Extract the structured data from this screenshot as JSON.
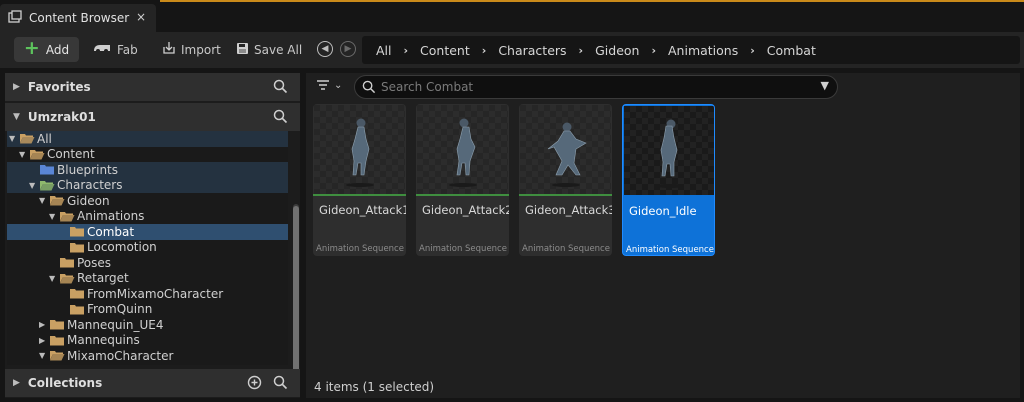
{
  "tab": {
    "title": "Content Browser",
    "close": "×"
  },
  "toolbar": {
    "add_label": "Add",
    "fab_label": "Fab",
    "import_label": "Import",
    "save_all_label": "Save All"
  },
  "breadcrumb": [
    "All",
    "Content",
    "Characters",
    "Gideon",
    "Animations",
    "Combat"
  ],
  "left_panel": {
    "favorites_label": "Favorites",
    "project_label": "Umzrak01",
    "collections_label": "Collections",
    "tree": [
      {
        "label": "All",
        "depth": 0,
        "expanded": true,
        "band": true
      },
      {
        "label": "Content",
        "depth": 1,
        "expanded": true,
        "band": false
      },
      {
        "label": "Blueprints",
        "depth": 2,
        "expanded": null,
        "band": true,
        "folder": "blue"
      },
      {
        "label": "Characters",
        "depth": 2,
        "expanded": true,
        "band": true
      },
      {
        "label": "Gideon",
        "depth": 3,
        "expanded": true,
        "band": false
      },
      {
        "label": "Animations",
        "depth": 4,
        "expanded": true,
        "band": false
      },
      {
        "label": "Combat",
        "depth": 5,
        "expanded": null,
        "selected": true
      },
      {
        "label": "Locomotion",
        "depth": 5,
        "expanded": null
      },
      {
        "label": "Poses",
        "depth": 4,
        "expanded": null
      },
      {
        "label": "Retarget",
        "depth": 4,
        "expanded": true
      },
      {
        "label": "FromMixamoCharacter",
        "depth": 5,
        "expanded": null
      },
      {
        "label": "FromQuinn",
        "depth": 5,
        "expanded": null
      },
      {
        "label": "Mannequin_UE4",
        "depth": 3,
        "expanded": false
      },
      {
        "label": "Mannequins",
        "depth": 3,
        "expanded": false
      },
      {
        "label": "MixamoCharacter",
        "depth": 3,
        "expanded": true
      }
    ]
  },
  "search": {
    "placeholder": "Search Combat"
  },
  "assets": [
    {
      "name": "Gideon_Attack1",
      "type": "Animation Sequence",
      "selected": false
    },
    {
      "name": "Gideon_Attack2",
      "type": "Animation Sequence",
      "selected": false
    },
    {
      "name": "Gideon_Attack3",
      "type": "Animation Sequence",
      "selected": false
    },
    {
      "name": "Gideon_Idle",
      "type": "Animation Sequence",
      "selected": true
    }
  ],
  "status": "4 items (1 selected)",
  "colors": {
    "accent": "#c98a1a",
    "selection": "#0e72d8",
    "folder": "#c9a063",
    "asset_bar": "#3f8e3f"
  }
}
